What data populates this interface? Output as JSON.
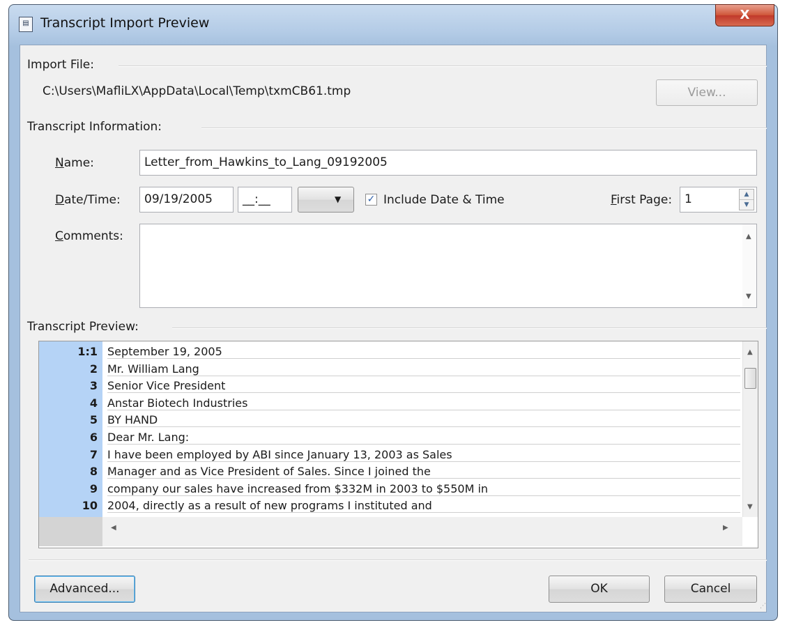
{
  "window": {
    "title": "Transcript Import Preview",
    "icon": "document-icon",
    "close_label": "X"
  },
  "import_file": {
    "label": "Import File:",
    "path": "C:\\Users\\MafliLX\\AppData\\Local\\Temp\\txmCB61.tmp",
    "view_button": "View..."
  },
  "info": {
    "label": "Transcript Information:",
    "name_label_u": "N",
    "name_label_rest": "ame:",
    "name_value": "Letter_from_Hawkins_to_Lang_09192005",
    "datetime_label_u": "D",
    "datetime_label_rest": "ate/Time:",
    "date_value": "09/19/2005",
    "time_value": "__:__",
    "ampm_value": "",
    "include_check": "✓",
    "include_label": "Include Date & Time",
    "first_page_label_u": "F",
    "first_page_label_rest": "irst Page:",
    "first_page_value": "1",
    "comments_label_u": "C",
    "comments_label_rest": "omments:",
    "comments_value": ""
  },
  "preview": {
    "label": "Transcript Preview:",
    "lines": [
      {
        "num": "1:1",
        "text": "September 19, 2005"
      },
      {
        "num": "2",
        "text": "Mr. William Lang"
      },
      {
        "num": "3",
        "text": "Senior Vice President"
      },
      {
        "num": "4",
        "text": "Anstar Biotech Industries"
      },
      {
        "num": "5",
        "text": "BY HAND"
      },
      {
        "num": "6",
        "text": "Dear Mr. Lang:"
      },
      {
        "num": "7",
        "text": "I have been employed by ABI since January 13, 2003 as Sales"
      },
      {
        "num": "8",
        "text": "Manager and as Vice President of Sales. Since I joined the"
      },
      {
        "num": "9",
        "text": "company our sales have increased from $332M in 2003 to $550M in"
      },
      {
        "num": "10",
        "text": "2004, directly as a result of new programs I instituted and"
      }
    ]
  },
  "buttons": {
    "advanced": "Advanced...",
    "ok": "OK",
    "cancel": "Cancel"
  }
}
